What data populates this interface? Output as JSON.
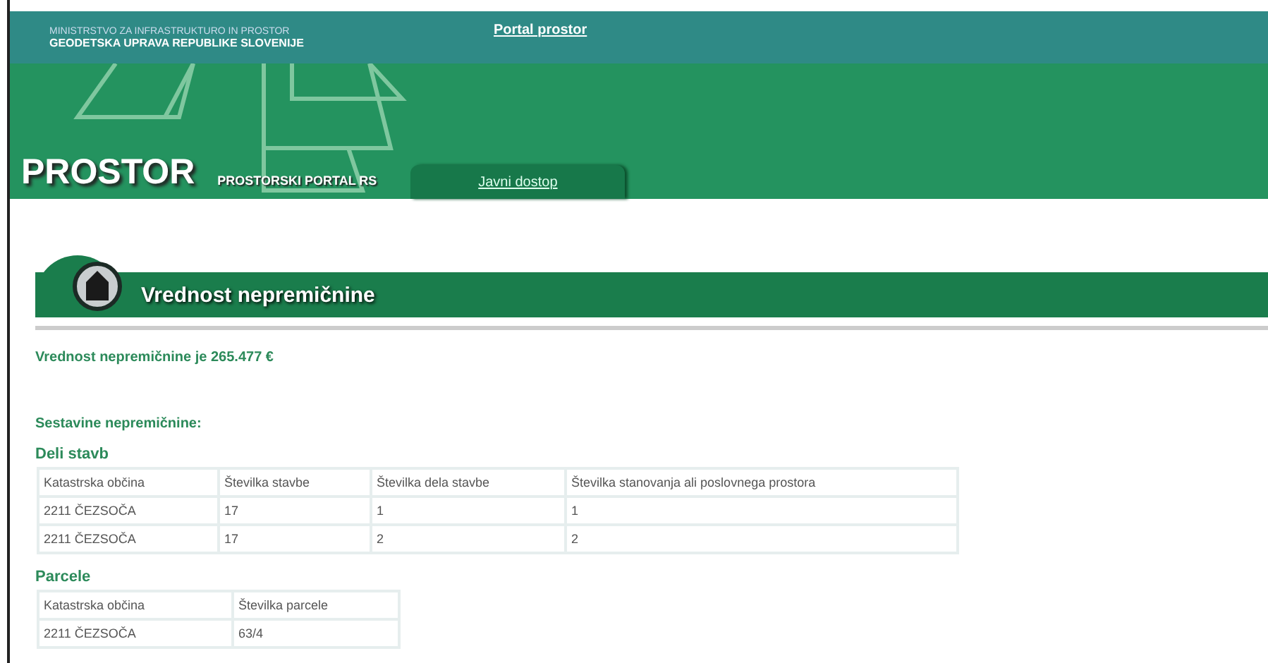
{
  "header": {
    "ministry": "MINISTRSTVO ZA INFRASTRUKTURO IN PROSTOR",
    "agency": "GEODETSKA UPRAVA REPUBLIKE SLOVENIJE",
    "portal_link": "Portal prostor",
    "logo": "PROSTOR",
    "subtitle": "PROSTORSKI PORTAL RS",
    "tabs": [
      {
        "label": "Javni dostop",
        "selected": true
      }
    ]
  },
  "section": {
    "title": "Vrednost nepremičnine"
  },
  "value_text": "Vrednost nepremičnine je 265.477 €",
  "components_heading": "Sestavine nepremičnine:",
  "tables": [
    {
      "title": "Deli stavb",
      "columns": [
        "Katastrska občina",
        "Številka stavbe",
        "Številka dela stavbe",
        "Številka stanovanja ali poslovnega prostora"
      ],
      "rows": [
        [
          "2211 ČEZSOČA",
          "17",
          "1",
          "1"
        ],
        [
          "2211 ČEZSOČA",
          "17",
          "2",
          "2"
        ]
      ]
    },
    {
      "title": "Parcele",
      "columns": [
        "Katastrska občina",
        "Številka parcele"
      ],
      "rows": [
        [
          "2211 ČEZSOČA",
          "63/4"
        ]
      ]
    }
  ]
}
